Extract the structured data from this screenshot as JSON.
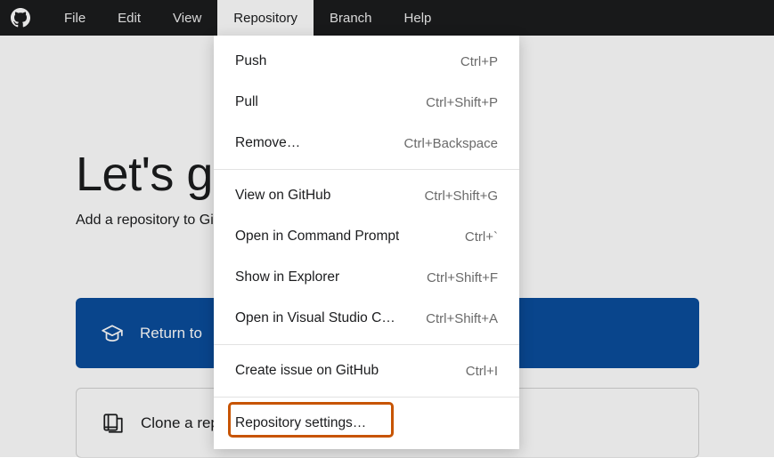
{
  "menubar": {
    "items": [
      {
        "label": "File"
      },
      {
        "label": "Edit"
      },
      {
        "label": "View"
      },
      {
        "label": "Repository"
      },
      {
        "label": "Branch"
      },
      {
        "label": "Help"
      }
    ]
  },
  "content": {
    "heading": "Let's get started!",
    "subheading": "Add a repository to GitHub Desktop to start collaborating",
    "primary_card": {
      "label": "Return to"
    },
    "secondary_card": {
      "label": "Clone a repository"
    }
  },
  "dropdown": {
    "groups": [
      [
        {
          "label": "Push",
          "shortcut": "Ctrl+P"
        },
        {
          "label": "Pull",
          "shortcut": "Ctrl+Shift+P"
        },
        {
          "label": "Remove…",
          "shortcut": "Ctrl+Backspace"
        }
      ],
      [
        {
          "label": "View on GitHub",
          "shortcut": "Ctrl+Shift+G"
        },
        {
          "label": "Open in Command Prompt",
          "shortcut": "Ctrl+`"
        },
        {
          "label": "Show in Explorer",
          "shortcut": "Ctrl+Shift+F"
        },
        {
          "label": "Open in Visual Studio C…",
          "shortcut": "Ctrl+Shift+A"
        }
      ],
      [
        {
          "label": "Create issue on GitHub",
          "shortcut": "Ctrl+I"
        }
      ],
      [
        {
          "label": "Repository settings…",
          "shortcut": ""
        }
      ]
    ]
  }
}
